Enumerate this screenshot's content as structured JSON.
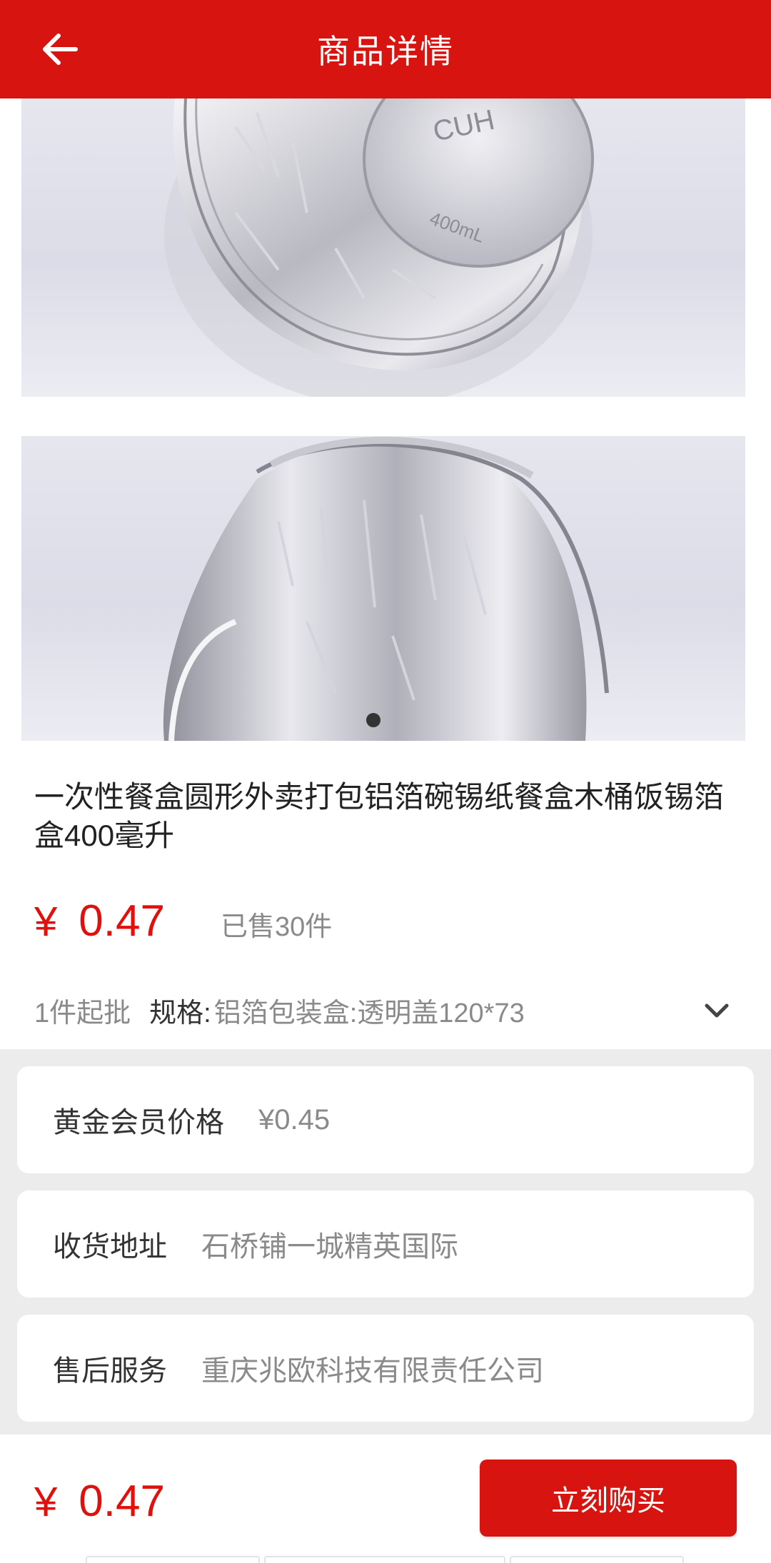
{
  "header": {
    "title": "商品详情",
    "back_icon": "arrow-left-icon"
  },
  "colors": {
    "brand_red": "#d7140f",
    "price_red": "#e0100c"
  },
  "product": {
    "title": "一次性餐盒圆形外卖打包铝箔碗锡纸餐盒木桶饭锡箔盒400毫升",
    "currency": "¥",
    "price": "0.47",
    "sold": "已售30件",
    "moq": "1件起批",
    "spec_label": "规格:",
    "spec_value": "铝箔包装盒:透明盖120*73",
    "image_1_text": "CUH",
    "image_1_volume": "400mL"
  },
  "info_cards": [
    {
      "label": "黄金会员价格",
      "value": "¥0.45"
    },
    {
      "label": "收货地址",
      "value": "石桥铺一城精英国际"
    },
    {
      "label": "售后服务",
      "value": "重庆兆欧科技有限责任公司"
    }
  ],
  "footer": {
    "currency": "¥",
    "price": "0.47",
    "buy_label": "立刻购买"
  }
}
